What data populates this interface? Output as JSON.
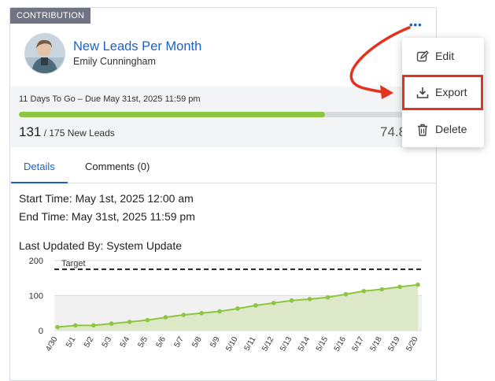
{
  "card": {
    "badge": "CONTRIBUTION",
    "title": "New Leads Per Month",
    "owner": "Emily Cunningham",
    "more_icon": "more-horizontal-icon",
    "due_text": "11 Days To Go – Due May 31st, 2025 11:59 pm",
    "progress_fraction": 0.749,
    "current": "131",
    "target_text": "/ 175 New Leads",
    "percent_visible": "74.8",
    "colors": {
      "accent": "#1a62c7",
      "progress": "#8dc63f",
      "badge": "#6f7484"
    }
  },
  "tabs": [
    {
      "label": "Details",
      "active": true
    },
    {
      "label": "Comments (0)",
      "active": false
    }
  ],
  "details": {
    "start": "Start Time: May 1st, 2025 12:00 am",
    "end": "End Time: May 31st, 2025 11:59 pm",
    "updated": "Last Updated By: System Update"
  },
  "chart_data": {
    "type": "area",
    "title": "",
    "xlabel": "",
    "ylabel": "",
    "ylim": [
      0,
      200
    ],
    "yticks": [
      "0",
      "100",
      "200"
    ],
    "categories": [
      "4/30",
      "5/1",
      "5/2",
      "5/3",
      "5/4",
      "5/5",
      "5/6",
      "5/7",
      "5/8",
      "5/9",
      "5/10",
      "5/11",
      "5/12",
      "5/13",
      "5/14",
      "5/15",
      "5/16",
      "5/17",
      "5/18",
      "5/19",
      "5/20"
    ],
    "values": [
      10,
      15,
      15,
      20,
      25,
      30,
      38,
      45,
      50,
      55,
      63,
      72,
      79,
      86,
      90,
      95,
      104,
      113,
      118,
      125,
      131
    ],
    "target": {
      "label": "Target",
      "value": 175
    },
    "grid": true,
    "colors": {
      "line": "#8dc63f",
      "fill": "#dde8c8",
      "plot_bg": "#f1f1f1"
    }
  },
  "menu": {
    "items": [
      {
        "label": "Edit",
        "icon": "edit-icon"
      },
      {
        "label": "Export",
        "icon": "download-icon",
        "highlighted": true
      },
      {
        "label": "Delete",
        "icon": "trash-icon"
      }
    ],
    "annotation_color": "#e3321d"
  }
}
